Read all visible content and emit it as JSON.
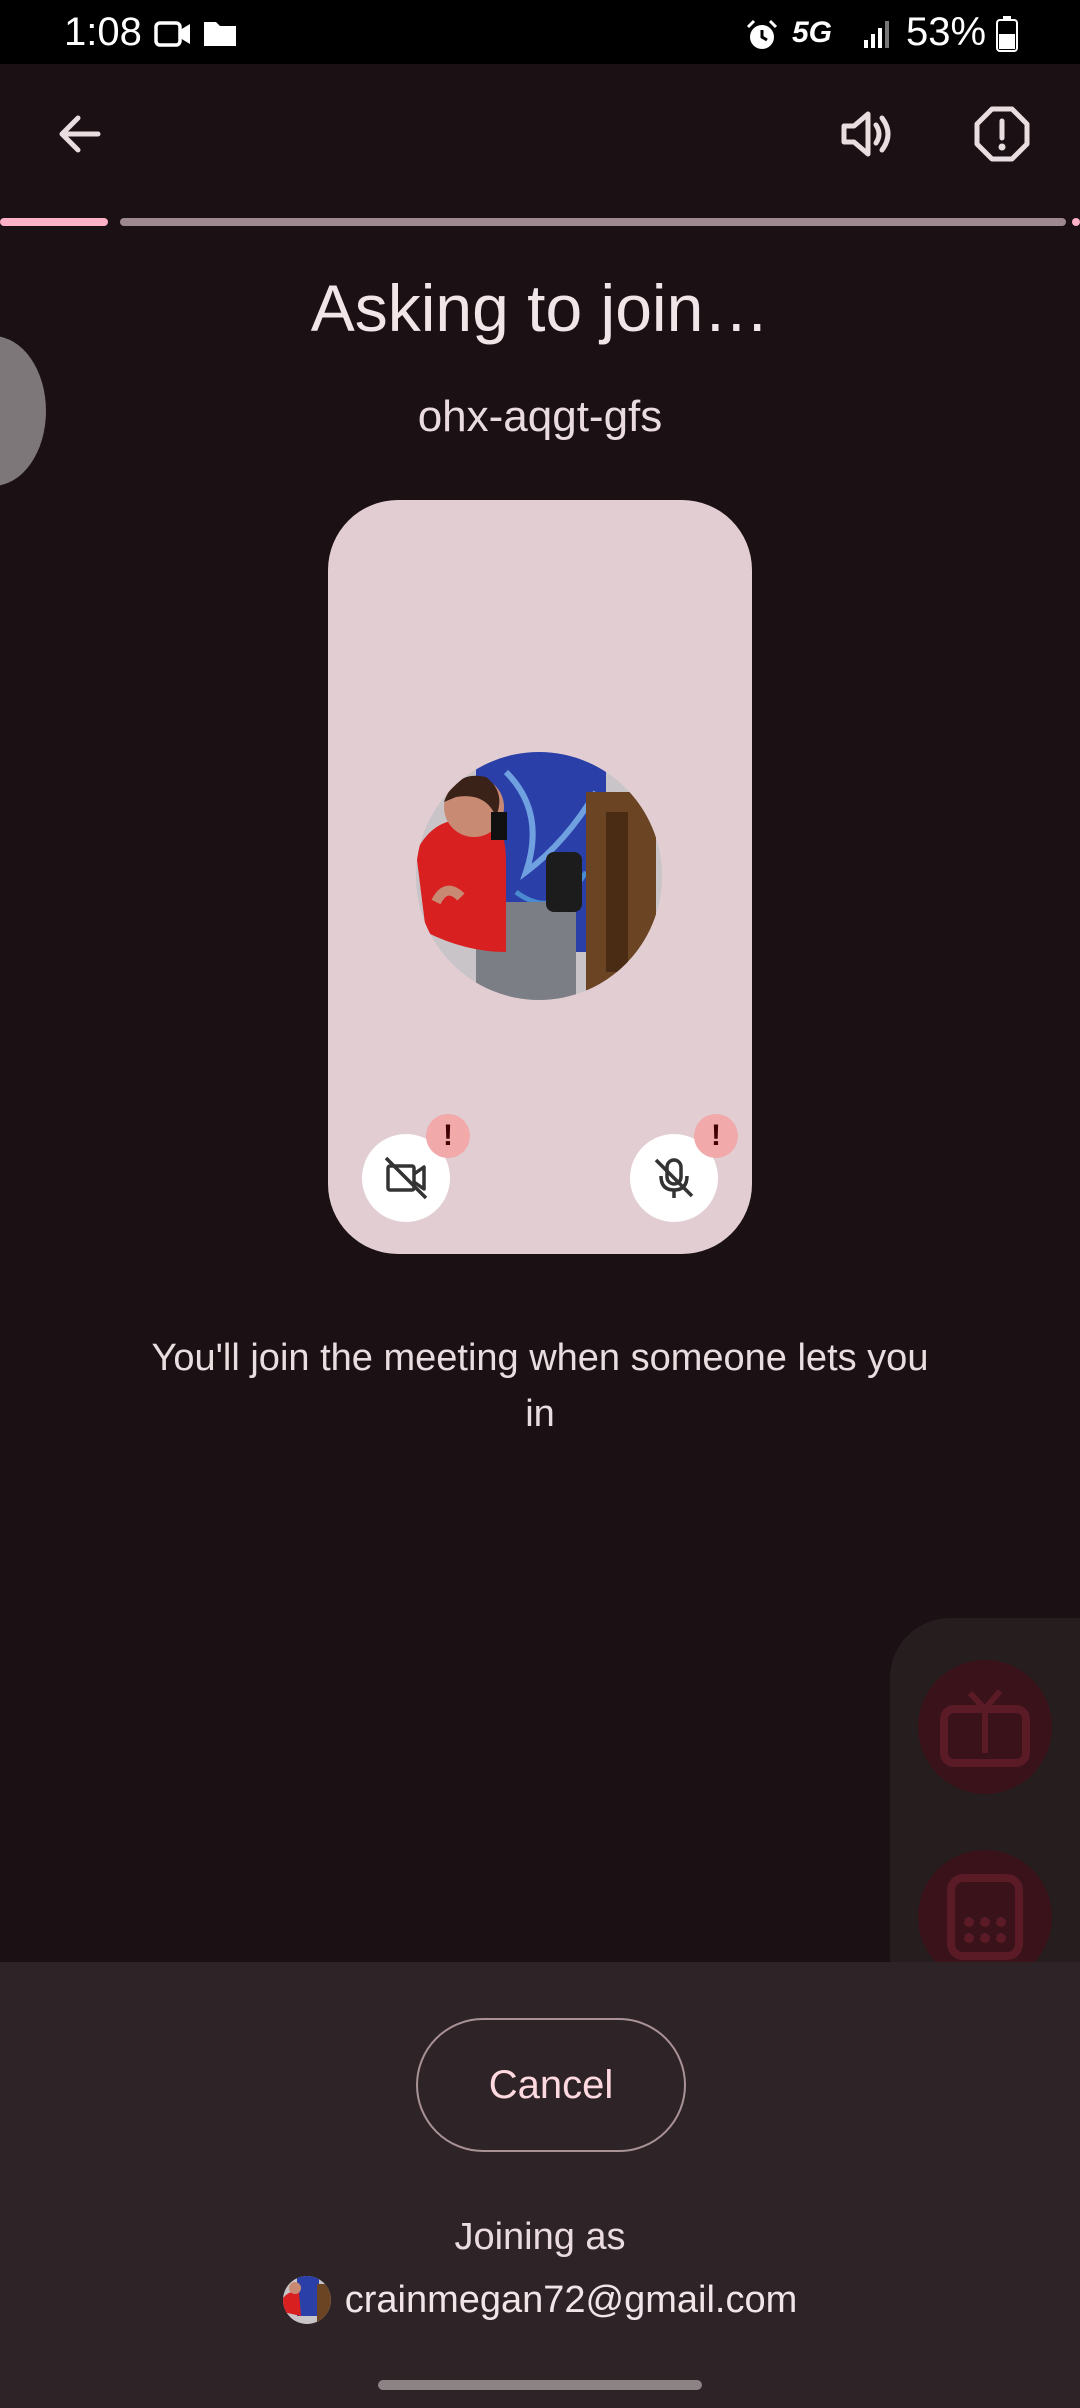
{
  "status_bar": {
    "time": "1:08",
    "network": "5G",
    "battery": "53%"
  },
  "header": {
    "back_icon": "arrow-left-icon",
    "audio_icon": "speaker-icon",
    "report_icon": "report-icon"
  },
  "progress": {
    "fraction": 0.1
  },
  "main": {
    "title": "Asking to join…",
    "meeting_code": "ohx-aqgt-gfs",
    "notice": "You'll join the meeting when someone lets you in"
  },
  "preview": {
    "camera_icon": "camera-off-icon",
    "mic_icon": "mic-off-icon",
    "alert_mark": "!"
  },
  "bottom": {
    "cancel_label": "Cancel",
    "joining_label": "Joining as",
    "email": "crainmegan72@gmail.com"
  },
  "colors": {
    "background": "#1b1114",
    "preview_tile": "#e2cdd2",
    "accent": "#ffb1c8",
    "sheet": "#2e2427"
  }
}
